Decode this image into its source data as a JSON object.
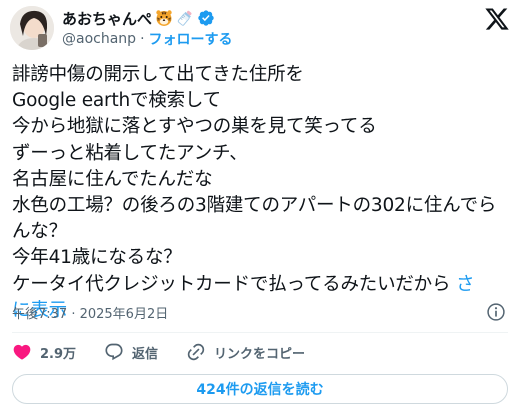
{
  "author": {
    "display_name": "あおちゃんぺ",
    "handle": "@aochanp",
    "separator": "·",
    "follow_label": "フォローする",
    "emoji_icons": [
      "tiger-face-icon",
      "baby-bottle-icon"
    ],
    "verified_icon": "verified-badge-icon",
    "verified_color": "#1d9bf0"
  },
  "tweet": {
    "lines": [
      "誹謗中傷の開示して出てきた住所を",
      "Google earthで検索して",
      "今から地獄に落とすやつの巣を見て笑ってる",
      "ずーっと粘着してたアンチ、",
      "名古屋に住んでたんだな",
      "水色の工場？の後ろの3階建てのアパートの302に住んでら",
      "んな？",
      "今年41歳になるな？",
      "ケータイ代クレジットカードで払ってるみたいだから "
    ],
    "show_more": "さらに表示",
    "show_more_cont": "に表示",
    "timestamp": "午後7:37 · 2025年6月2日"
  },
  "actions": {
    "like_count": "2.9万",
    "reply_label": "返信",
    "copy_link_label": "リンクをコピー"
  },
  "read_replies_label": "424件の返信を読む",
  "colors": {
    "accent": "#1d9bf0",
    "like_red": "#f91880",
    "text": "#0f1419",
    "muted": "#536471"
  }
}
